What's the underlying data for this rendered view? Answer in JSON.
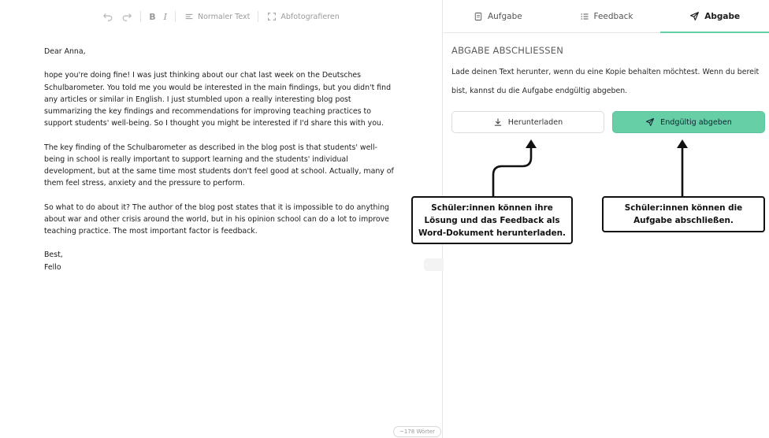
{
  "toolbar": {
    "undo_icon": "undo-icon",
    "redo_icon": "redo-icon",
    "bold_label": "B",
    "italic_label": "I",
    "text_style_label": "Normaler Text",
    "photo_label": "Abfotografieren"
  },
  "document": {
    "greeting": "Dear Anna,",
    "paragraphs": [
      "hope you're doing fine! I was just thinking about our chat last week on the Deutsches Schulbarometer. You told me you would be interested in the main findings, but you didn't find any articles or similar in English. I just stumbled upon a really interesting blog post summarizing the key findings and recommendations for improving teaching practices to support students' well-being. So I thought you might be interested if I'd share this with you.",
      "The key finding of the Schulbarometer as described in the blog post is that students' well-being in school is really important to support learning and the students' individual development, but at the same time most students don't feel good at school. Actually, many of them feel stress, anxiety and the pressure to perform.",
      "So what to do about it? The author of the blog post states that it is impossible to do anything about war and other crisis around the world, but in his opinion school can do a lot to improve teaching practice. The most important factor is feedback."
    ],
    "closing": "Best,",
    "signature": "Fello",
    "word_count": "~178 Wörter"
  },
  "tabs": [
    {
      "label": "Aufgabe",
      "icon": "document-icon"
    },
    {
      "label": "Feedback",
      "icon": "list-icon"
    },
    {
      "label": "Abgabe",
      "icon": "send-icon"
    }
  ],
  "panel": {
    "title": "ABGABE ABSCHLIESSEN",
    "description": "Lade deinen Text herunter, wenn du eine Kopie behalten möchtest. Wenn du bereit bist, kannst du die Aufgabe endgültig abgeben.",
    "download_label": "Herunterladen",
    "submit_label": "Endgültig abgeben"
  },
  "annotations": {
    "download_note": "Schüler:innen können ihre Lösung und das Feedback als Word-Dokument herunterladen.",
    "submit_note": "Schüler:innen können die Aufgabe abschließen."
  },
  "colors": {
    "accent": "#66cfa6",
    "border": "#e4e4e4",
    "muted_text": "#9a9a9a"
  }
}
